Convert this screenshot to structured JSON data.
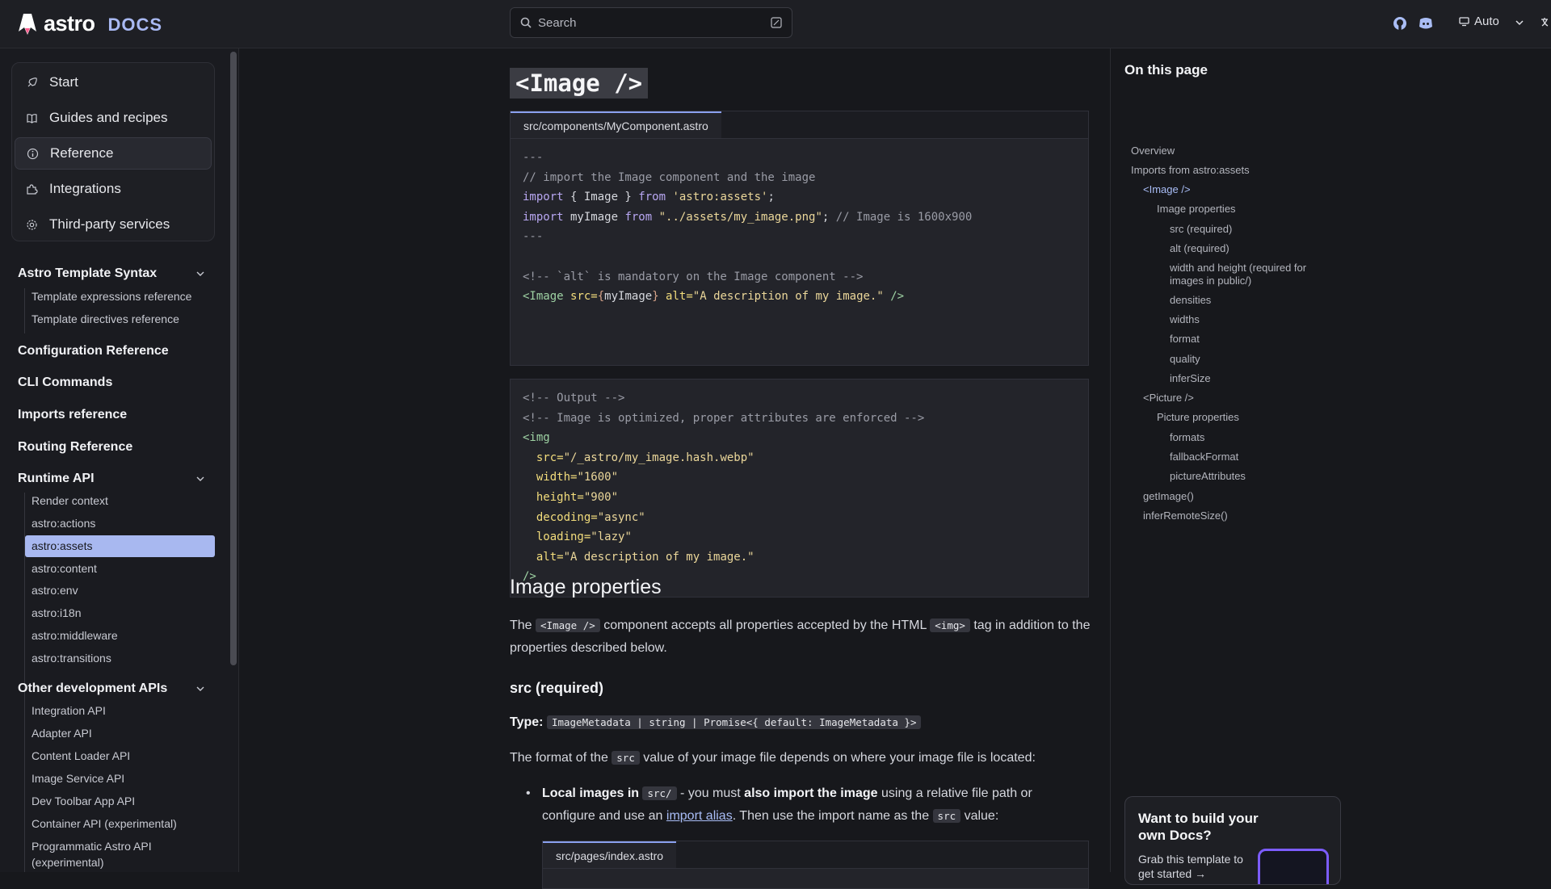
{
  "header": {
    "logo_text": "astro",
    "logo_docs": "DOCS",
    "search_placeholder": "Search",
    "theme_label": "Auto",
    "icons": [
      "github-icon",
      "discord-icon",
      "monitor-icon",
      "chevron-down-icon",
      "language-icon"
    ]
  },
  "sidebar": {
    "top_nav": [
      {
        "label": "Start",
        "icon": "rocket-icon"
      },
      {
        "label": "Guides and recipes",
        "icon": "book-icon"
      },
      {
        "label": "Reference",
        "icon": "info-icon",
        "active": true
      },
      {
        "label": "Integrations",
        "icon": "puzzle-icon"
      },
      {
        "label": "Third-party services",
        "icon": "gear-icon"
      }
    ],
    "groups": {
      "template_syntax": "Astro Template Syntax",
      "template_items": [
        "Template expressions reference",
        "Template directives reference"
      ],
      "config_ref": "Configuration Reference",
      "cli": "CLI Commands",
      "imports_ref": "Imports reference",
      "routing_ref": "Routing Reference",
      "runtime_api": "Runtime API",
      "runtime_items": [
        "Render context",
        "astro:actions",
        "astro:assets",
        "astro:content",
        "astro:env",
        "astro:i18n",
        "astro:middleware",
        "astro:transitions"
      ],
      "other_apis": "Other development APIs",
      "other_items": [
        "Integration API",
        "Adapter API",
        "Content Loader API",
        "Image Service API",
        "Dev Toolbar App API",
        "Container API (experimental)",
        "Programmatic Astro API",
        "(experimental)"
      ]
    },
    "active_item": "astro:assets"
  },
  "main": {
    "heading": "<Image />",
    "code1": {
      "tab": "src/components/MyComponent.astro",
      "l1": "---",
      "l2": "// import the Image component and the image",
      "l3a": "import",
      "l3b": " { Image } ",
      "l3c": "from",
      "l3d": " 'astro:assets'",
      "l3e": ";",
      "l4a": "import",
      "l4b": " myImage ",
      "l4c": "from",
      "l4d": " \"../assets/my_image.png\"",
      "l4e": "; ",
      "l4f": "// Image is 1600x900",
      "l5": "---",
      "l7": "<!-- `alt` is mandatory on the Image component -->",
      "l8a": "<Image ",
      "l8b": "src=",
      "l8c": "{",
      "l8d": "myImage",
      "l8e": "}",
      "l8f": " alt=",
      "l8g": "\"A description of my image.\"",
      "l8h": " />"
    },
    "code2": {
      "l1": "<!-- Output -->",
      "l2": "<!-- Image is optimized, proper attributes are enforced -->",
      "l3": "<img",
      "attrs": [
        {
          "name": "src=",
          "value": "\"/_astro/my_image.hash.webp\""
        },
        {
          "name": "width=",
          "value": "\"1600\""
        },
        {
          "name": "height=",
          "value": "\"900\""
        },
        {
          "name": "decoding=",
          "value": "\"async\""
        },
        {
          "name": "loading=",
          "value": "\"lazy\""
        },
        {
          "name": "alt=",
          "value": "\"A description of my image.\""
        }
      ],
      "close": "/>"
    },
    "image_props_heading": "Image properties",
    "para1": {
      "t1": "The ",
      "c1": "<Image />",
      "t2": " component accepts all properties accepted by the HTML ",
      "c2": "<img>",
      "t3": " tag in addition to the properties described below."
    },
    "src_heading": "src (required)",
    "type_label": "Type:",
    "type_value": "ImageMetadata | string | Promise<{ default: ImageMetadata }>",
    "para2": {
      "t1": "The format of the ",
      "c1": "src",
      "t2": " value of your image file depends on where your image file is located:"
    },
    "bullet": {
      "b1": "Local images in ",
      "c1": "src/",
      "t1": " - you must ",
      "b2": "also import the image",
      "t2": " using a relative file path or configure and use an ",
      "link": "import alias",
      "t3": ". Then use the import name as the ",
      "c2": "src",
      "t4": " value:"
    },
    "code3_tab": "src/pages/index.astro"
  },
  "toc": {
    "title": "On this page",
    "items": [
      {
        "label": "Overview",
        "level": 0
      },
      {
        "label": "Imports from astro:assets",
        "level": 0
      },
      {
        "label": "<Image />",
        "level": 1,
        "current": true
      },
      {
        "label": "Image properties",
        "level": 2
      },
      {
        "label": "src (required)",
        "level": 3
      },
      {
        "label": "alt (required)",
        "level": 3
      },
      {
        "label": "width and height (required for",
        "level": 3
      },
      {
        "label": "images in public/)",
        "level": 3
      },
      {
        "label": "densities",
        "level": 3
      },
      {
        "label": "widths",
        "level": 3
      },
      {
        "label": "format",
        "level": 3
      },
      {
        "label": "quality",
        "level": 3
      },
      {
        "label": "inferSize",
        "level": 3
      },
      {
        "label": "<Picture />",
        "level": 1
      },
      {
        "label": "Picture properties",
        "level": 2
      },
      {
        "label": "formats",
        "level": 3
      },
      {
        "label": "fallbackFormat",
        "level": 3
      },
      {
        "label": "pictureAttributes",
        "level": 3
      },
      {
        "label": "getImage()",
        "level": 1
      },
      {
        "label": "inferRemoteSize()",
        "level": 1
      }
    ],
    "promo": {
      "title": "Want to build your own Docs?",
      "text": "Grab this template to get started →"
    }
  },
  "colors": {
    "accent": "#a9bdf6",
    "active_bg": "#a8b8f0",
    "background": "#17181c"
  }
}
